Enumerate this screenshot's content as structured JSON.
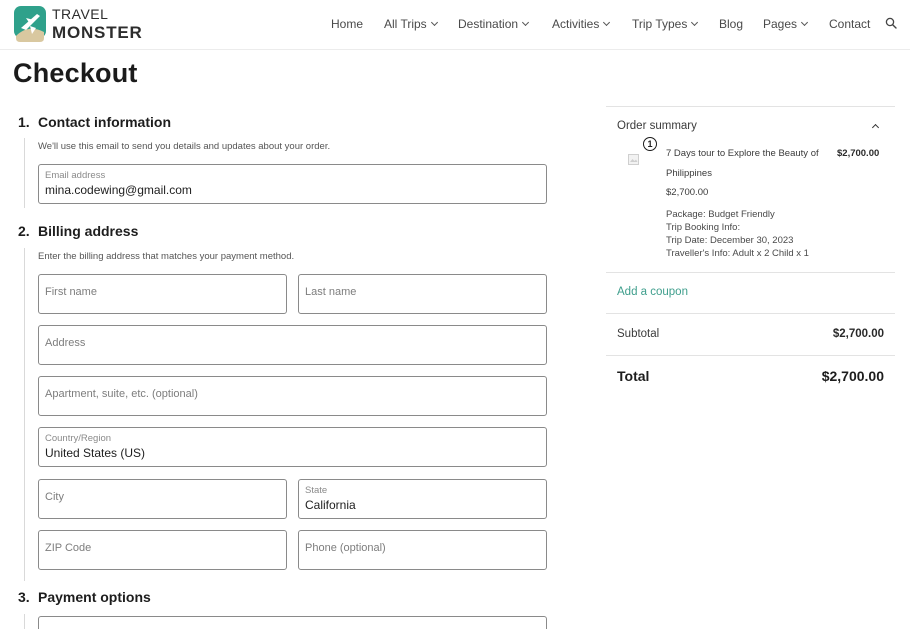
{
  "brand": {
    "line1": "TRAVEL",
    "line2": "MONSTER",
    "colors": {
      "teal": "#2fa18b",
      "sand": "#d9c8a0"
    }
  },
  "nav": {
    "items": [
      {
        "label": "Home",
        "dropdown": false
      },
      {
        "label": "All Trips",
        "dropdown": true
      },
      {
        "label": "Destination",
        "dropdown": true
      },
      {
        "label": "Activities",
        "dropdown": true
      },
      {
        "label": "Trip Types",
        "dropdown": true
      },
      {
        "label": "Blog",
        "dropdown": false
      },
      {
        "label": "Pages",
        "dropdown": true
      },
      {
        "label": "Contact",
        "dropdown": false
      }
    ],
    "search_icon": "search-icon"
  },
  "page": {
    "title": "Checkout"
  },
  "contact": {
    "number": "1.",
    "heading": "Contact information",
    "hint": "We'll use this email to send you details and updates about your order.",
    "email": {
      "label": "Email address",
      "value": "mina.codewing@gmail.com"
    }
  },
  "billing": {
    "number": "2.",
    "heading": "Billing address",
    "hint": "Enter the billing address that matches your payment method.",
    "first_name": {
      "placeholder": "First name"
    },
    "last_name": {
      "placeholder": "Last name"
    },
    "address": {
      "placeholder": "Address"
    },
    "apartment": {
      "placeholder": "Apartment, suite, etc. (optional)"
    },
    "country": {
      "label": "Country/Region",
      "value": "United States (US)"
    },
    "city": {
      "placeholder": "City"
    },
    "state": {
      "label": "State",
      "value": "California"
    },
    "zip": {
      "placeholder": "ZIP Code"
    },
    "phone": {
      "placeholder": "Phone (optional)"
    }
  },
  "payment": {
    "number": "3.",
    "heading": "Payment options"
  },
  "summary": {
    "title": "Order summary",
    "item": {
      "quantity": "1",
      "name": "7 Days tour to Explore the Beauty of Philippines",
      "price": "$2,700.00",
      "unit_price": "$2,700.00",
      "package": "Package: Budget Friendly",
      "booking_info": "Trip Booking Info:",
      "trip_date": "Trip Date: December 30, 2023",
      "travellers": "Traveller's Info: Adult x 2 Child x 1"
    },
    "coupon_label": "Add a coupon",
    "subtotal_label": "Subtotal",
    "subtotal_value": "$2,700.00",
    "total_label": "Total",
    "total_value": "$2,700.00",
    "accent_color": "#3e9e8c"
  }
}
